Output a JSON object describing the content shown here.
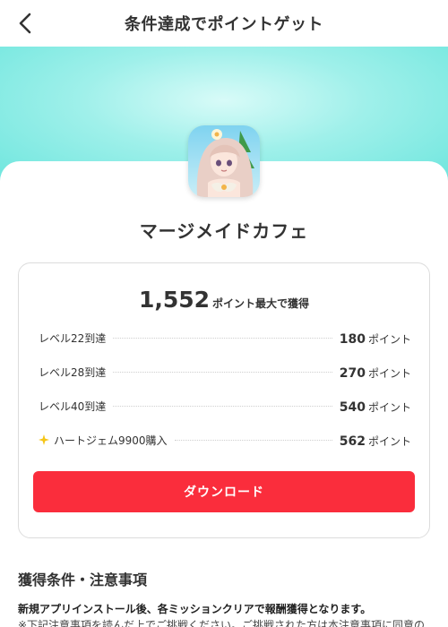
{
  "header": {
    "title": "条件達成でポイントゲット"
  },
  "app": {
    "name": "マージメイドカフェ"
  },
  "summary": {
    "total_points": "1,552",
    "total_label": "ポイント最大で獲得"
  },
  "missions": [
    {
      "label": "レベル22到達",
      "points": "180",
      "unit": "ポイント"
    },
    {
      "label": "レベル28到達",
      "points": "270",
      "unit": "ポイント"
    },
    {
      "label": "レベル40到達",
      "points": "540",
      "unit": "ポイント"
    },
    {
      "label": "ハートジェム9900購入",
      "points": "562",
      "unit": "ポイント",
      "icon": "sparkle-icon"
    }
  ],
  "download_button": {
    "label": "ダウンロード"
  },
  "conditions": {
    "title": "獲得条件・注意事項",
    "bold_note": "新規アプリインストール後、各ミッションクリアで報酬獲得となります。",
    "note": "※下記注意事項を読んだ上でご挑戦ください。ご挑戦された方は本注意事項に同意の"
  },
  "colors": {
    "accent": "#fa2d3c",
    "hero": "#6fe6de",
    "gem": "#f5c518"
  }
}
